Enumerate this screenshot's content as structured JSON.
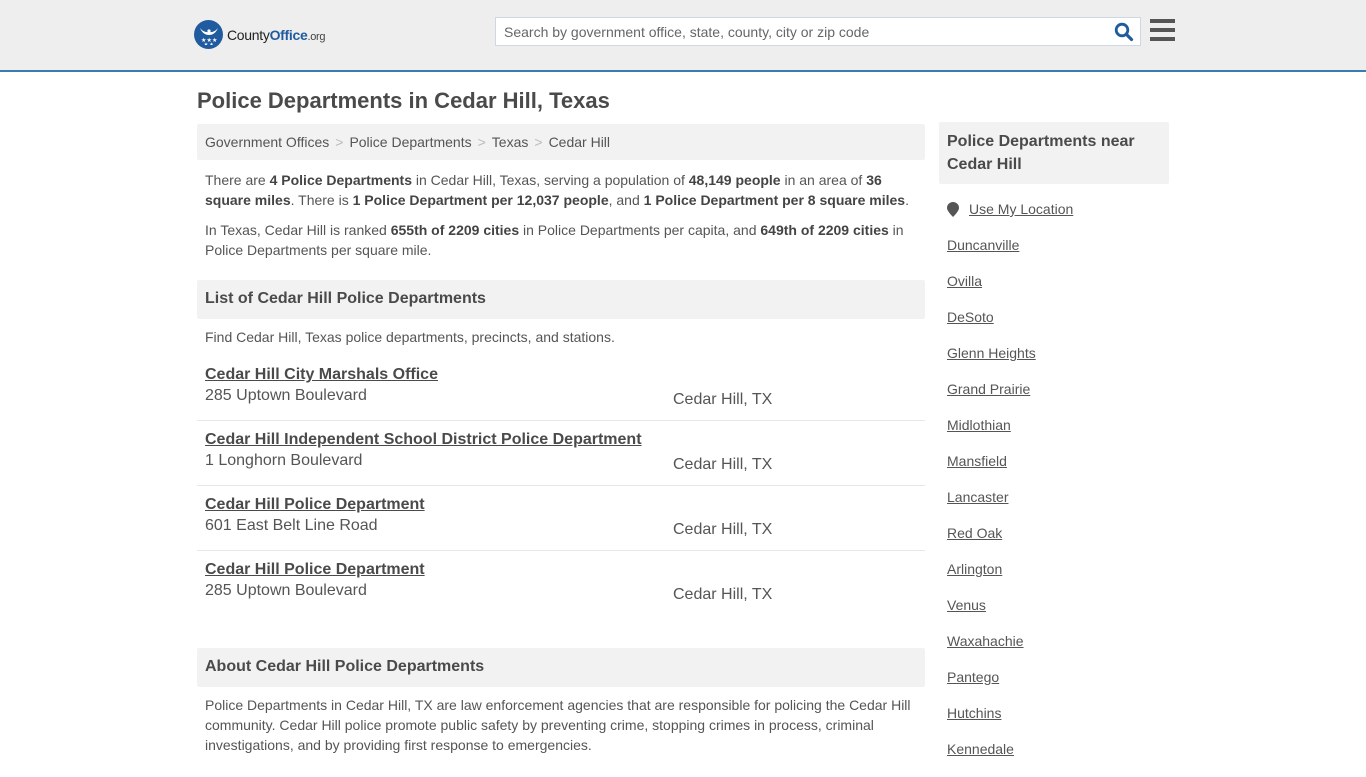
{
  "header": {
    "logo": {
      "brand_prefix": "County",
      "brand_main": "Office",
      "brand_suffix": ".org"
    },
    "search": {
      "placeholder": "Search by government office, state, county, city or zip code",
      "value": ""
    },
    "icons": {
      "search": "search-icon",
      "menu": "hamburger-menu-icon"
    }
  },
  "page": {
    "title": "Police Departments in Cedar Hill, Texas"
  },
  "breadcrumb": [
    {
      "label": "Government Offices"
    },
    {
      "label": "Police Departments"
    },
    {
      "label": "Texas"
    },
    {
      "label": "Cedar Hill"
    }
  ],
  "breadcrumb_separator": ">",
  "intro": {
    "p1": {
      "t1": "There are ",
      "b1": "4 Police Departments",
      "t2": " in Cedar Hill, Texas, serving a population of ",
      "b2": "48,149 people",
      "t3": " in an area of ",
      "b3": "36 square miles",
      "t4": ". There is ",
      "b4": "1 Police Department per 12,037 people",
      "t5": ", and ",
      "b5": "1 Police Department per 8 square miles",
      "t6": "."
    },
    "p2": {
      "t1": "In Texas, Cedar Hill is ranked ",
      "b1": "655th of 2209 cities",
      "t2": " in Police Departments per capita, and ",
      "b2": "649th of 2209 cities",
      "t3": " in Police Departments per square mile."
    }
  },
  "list_section": {
    "heading": "List of Cedar Hill Police Departments",
    "description": "Find Cedar Hill, Texas police departments, precincts, and stations.",
    "departments": [
      {
        "name": "Cedar Hill City Marshals Office",
        "address": "285 Uptown Boulevard",
        "city": "Cedar Hill, TX"
      },
      {
        "name": "Cedar Hill Independent School District Police Department",
        "address": "1 Longhorn Boulevard",
        "city": "Cedar Hill, TX"
      },
      {
        "name": "Cedar Hill Police Department",
        "address": "601 East Belt Line Road",
        "city": "Cedar Hill, TX"
      },
      {
        "name": "Cedar Hill Police Department",
        "address": "285 Uptown Boulevard",
        "city": "Cedar Hill, TX"
      }
    ]
  },
  "about_section": {
    "heading": "About Cedar Hill Police Departments",
    "text": "Police Departments in Cedar Hill, TX are law enforcement agencies that are responsible for policing the Cedar Hill community. Cedar Hill police promote public safety by preventing crime, stopping crimes in process, criminal investigations, and by providing first response to emergencies."
  },
  "sidebar": {
    "heading": "Police Departments near Cedar Hill",
    "use_location": "Use My Location",
    "cities": [
      "Duncanville",
      "Ovilla",
      "DeSoto",
      "Glenn Heights",
      "Grand Prairie",
      "Midlothian",
      "Mansfield",
      "Lancaster",
      "Red Oak",
      "Arlington",
      "Venus",
      "Waxahachie",
      "Pantego",
      "Hutchins",
      "Kennedale"
    ]
  },
  "colors": {
    "brand_blue": "#1f5b9e",
    "header_border": "#3a7cb0",
    "header_bg": "#eeeeee",
    "panel_bg": "#f2f2f2",
    "text": "#555555"
  }
}
